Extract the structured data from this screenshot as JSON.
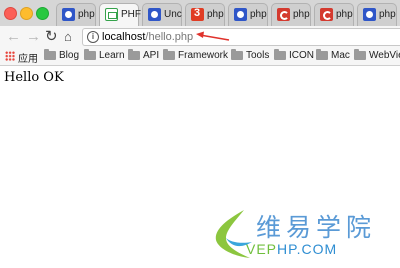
{
  "tabs": [
    {
      "label": "php",
      "icon": "paw-icon",
      "active": false
    },
    {
      "label": "PHF",
      "icon": "php-file-icon",
      "active": false
    },
    {
      "label": "Unc",
      "icon": "paw-icon",
      "active": false
    },
    {
      "label": "php",
      "icon": "number-three-icon",
      "active": false
    },
    {
      "label": "php",
      "icon": "paw-icon",
      "active": false
    },
    {
      "label": "php",
      "icon": "c-logo-icon",
      "active": false
    },
    {
      "label": "php",
      "icon": "c-logo-icon",
      "active": false
    },
    {
      "label": "php",
      "icon": "paw-icon",
      "active": false
    }
  ],
  "address": {
    "host": "localhost",
    "path": "/hello.php"
  },
  "bookmarks": {
    "apps_label": "应用",
    "items": [
      "Blog",
      "Learn",
      "API",
      "Framework",
      "Tools",
      "ICON",
      "Mac",
      "WebVie"
    ]
  },
  "page": {
    "text": "Hello OK"
  },
  "watermark": {
    "cn": "维易学院",
    "en_prefix": "VEP",
    "en_suffix": "HP.COM"
  },
  "colors": {
    "annotation_arrow": "#e0322c",
    "watermark_blue": "#2f8ed2",
    "watermark_green": "#6fbf3c"
  }
}
